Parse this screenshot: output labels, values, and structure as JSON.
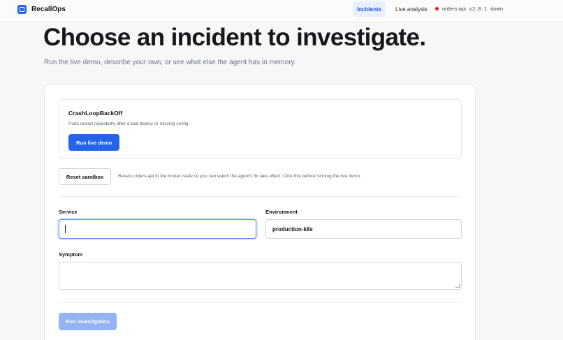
{
  "app": {
    "brand": "RecallOps"
  },
  "nav": {
    "incidents": "Incidents",
    "live_analysis": "Live analysis"
  },
  "status": {
    "service": "orders-api",
    "version": "v2.8.1",
    "state": "down",
    "color": "#d61f1f"
  },
  "page": {
    "title": "Choose an incident to investigate.",
    "subtitle": "Run the live demo, describe your own, or see what else the agent has in memory."
  },
  "scenario": {
    "name": "CrashLoopBackOff",
    "description": "Pods restart repeatedly after a bad deploy or missing config",
    "button": "Run live demo"
  },
  "sandbox": {
    "button": "Reset sandbox",
    "note": "Resets orders-api to the broken state so you can watch the agent's fix take effect. Click this before running the live demo."
  },
  "form": {
    "service_label": "Service",
    "service_value": "",
    "environment_label": "Environment",
    "environment_value": "production-k8s",
    "symptom_label": "Symptom",
    "symptom_value": "",
    "submit": "Run investigation"
  },
  "colors": {
    "accent": "#2563eb",
    "disabled": "#93b4f3"
  }
}
